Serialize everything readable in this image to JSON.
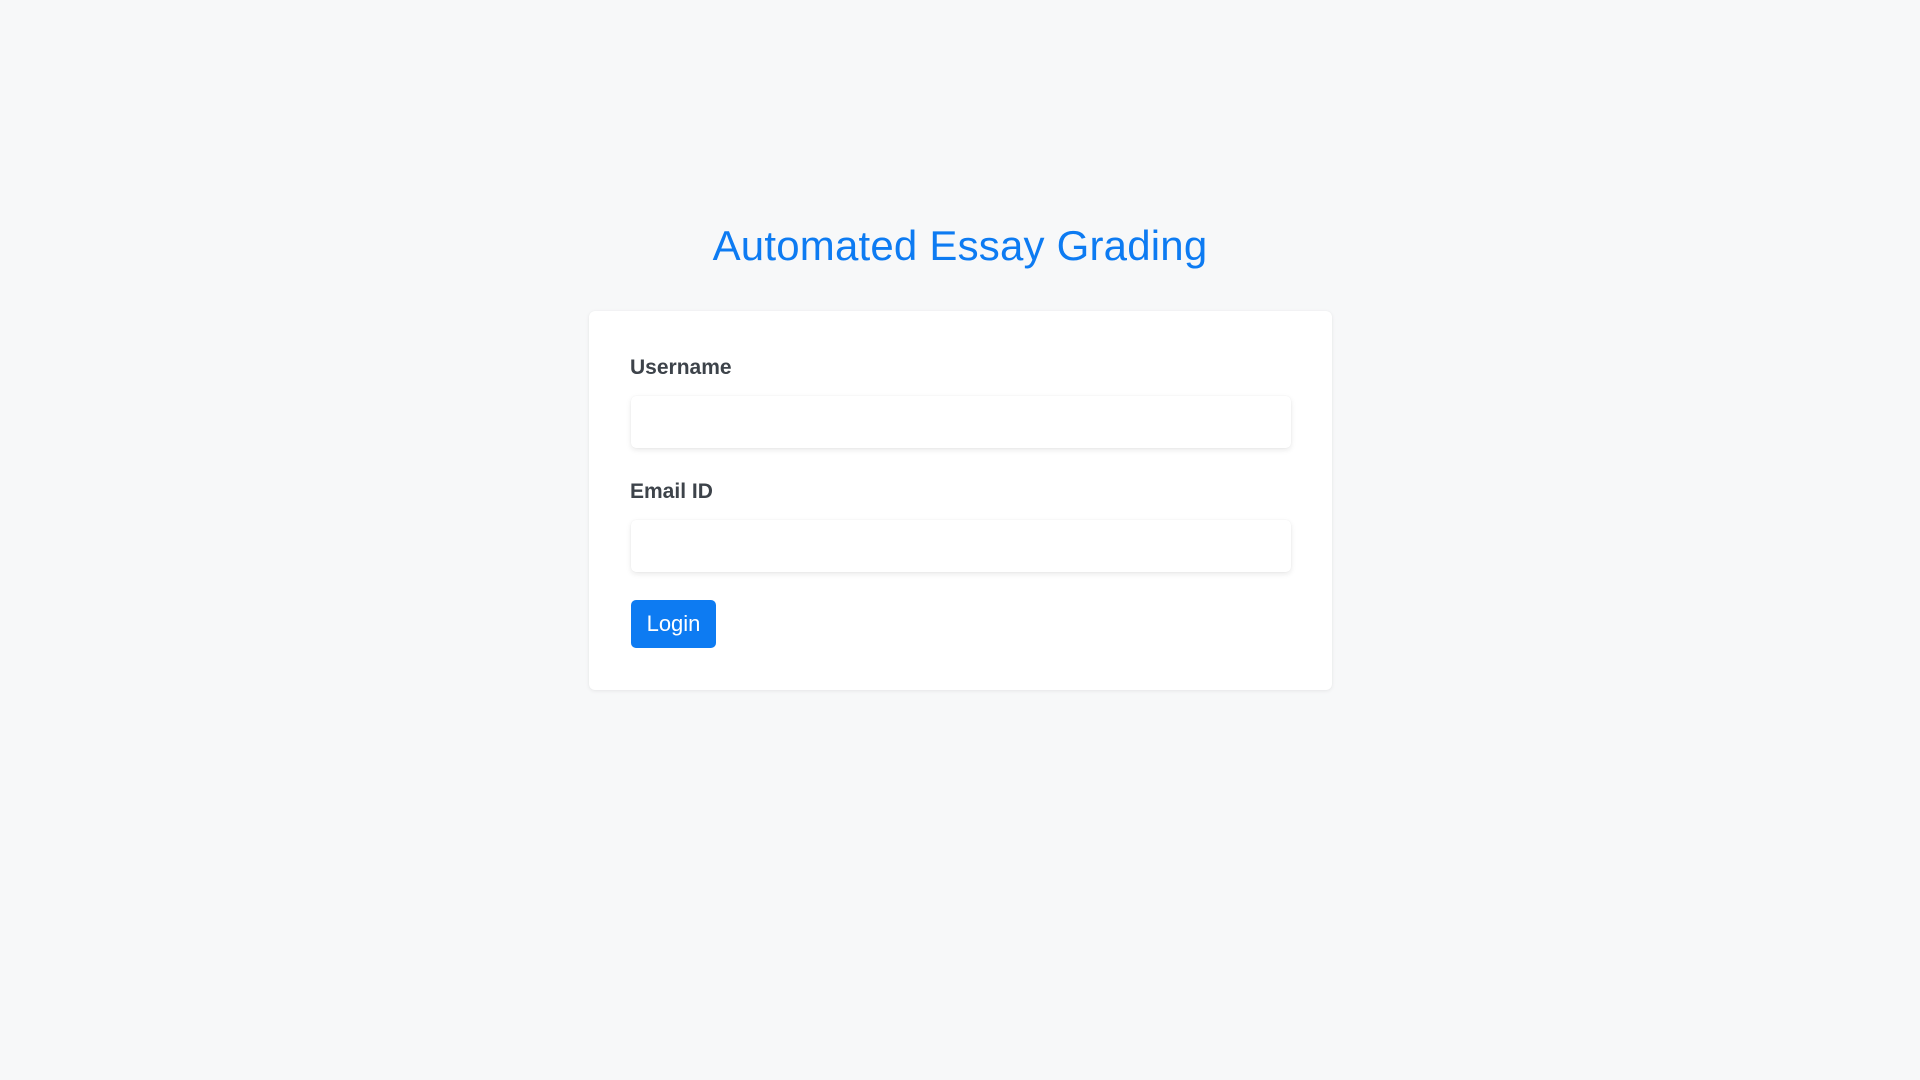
{
  "app": {
    "title": "Automated Essay Grading"
  },
  "form": {
    "username_label": "Username",
    "username_value": "",
    "email_label": "Email ID",
    "email_value": "",
    "login_label": "Login"
  },
  "colors": {
    "accent": "#0d7bf2",
    "background": "#f7f8f9",
    "card": "#ffffff",
    "label_text": "#3d434a"
  }
}
